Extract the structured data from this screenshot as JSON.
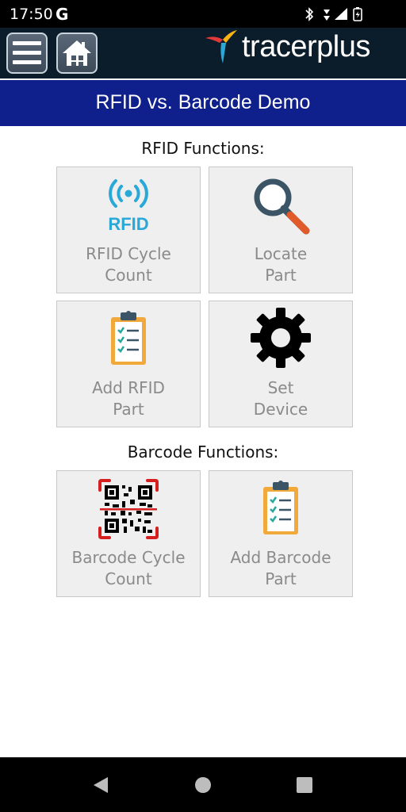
{
  "status_bar": {
    "time": "17:50",
    "g_label": "G"
  },
  "header": {
    "menu_icon": "hamburger-menu-icon",
    "home_icon": "home-icon",
    "logo_text": "tracerplus"
  },
  "title_bar": {
    "title": "RFID vs. Barcode Demo"
  },
  "rfid_section": {
    "heading": "RFID Functions:",
    "tiles": [
      {
        "icon": "rfid-icon",
        "icon_text": "RFID",
        "line1": "RFID Cycle",
        "line2": "Count"
      },
      {
        "icon": "magnifier-icon",
        "line1": "Locate",
        "line2": "Part"
      },
      {
        "icon": "clipboard-icon",
        "line1": "Add RFID",
        "line2": "Part"
      },
      {
        "icon": "gear-icon",
        "line1": "Set",
        "line2": "Device"
      }
    ]
  },
  "barcode_section": {
    "heading": "Barcode Functions:",
    "tiles": [
      {
        "icon": "qr-code-icon",
        "line1": "Barcode Cycle",
        "line2": "Count"
      },
      {
        "icon": "clipboard-icon",
        "line1": "Add Barcode",
        "line2": "Part"
      }
    ]
  },
  "nav_bar": {
    "back_icon": "back-triangle-icon",
    "home_icon": "home-circle-icon",
    "recents_icon": "recents-square-icon"
  },
  "colors": {
    "title_bar": "#0f1f8c",
    "header": "#0b1d2a",
    "rfid_blue": "#2aa8d8",
    "tile_bg": "#efefef",
    "tile_text": "#8a8a8a"
  }
}
